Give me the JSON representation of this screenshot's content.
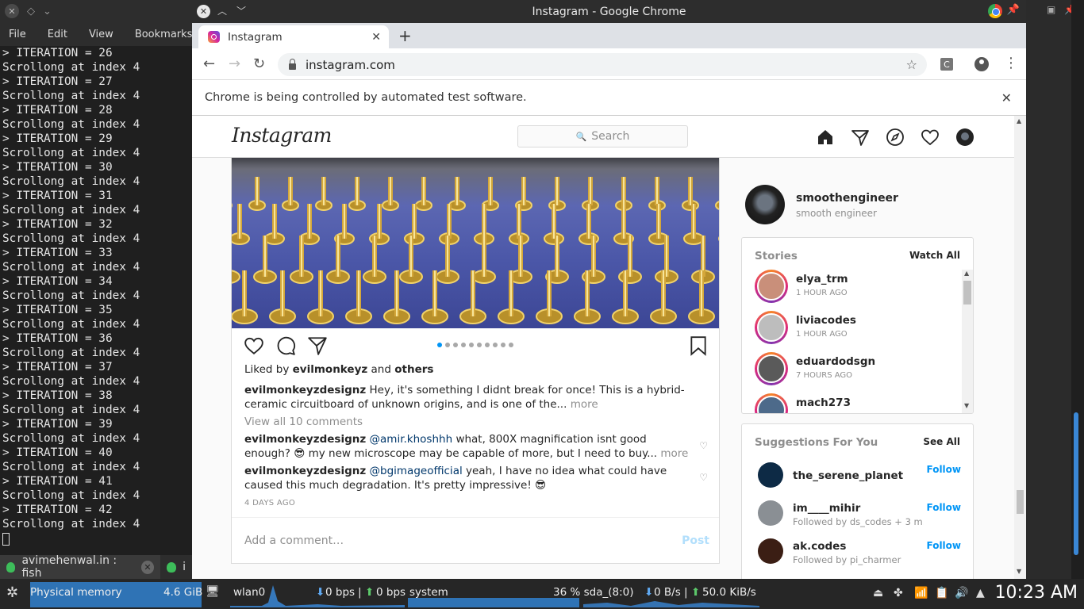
{
  "terminal": {
    "menu": [
      "File",
      "Edit",
      "View",
      "Bookmarks"
    ],
    "lines": [
      "> ITERATION = 26",
      "Scrollong at index 4",
      "> ITERATION = 27",
      "Scrollong at index 4",
      "> ITERATION = 28",
      "Scrollong at index 4",
      "> ITERATION = 29",
      "Scrollong at index 4",
      "> ITERATION = 30",
      "Scrollong at index 4",
      "> ITERATION = 31",
      "Scrollong at index 4",
      "> ITERATION = 32",
      "Scrollong at index 4",
      "> ITERATION = 33",
      "Scrollong at index 4",
      "> ITERATION = 34",
      "Scrollong at index 4",
      "> ITERATION = 35",
      "Scrollong at index 4",
      "> ITERATION = 36",
      "Scrollong at index 4",
      "> ITERATION = 37",
      "Scrollong at index 4",
      "> ITERATION = 38",
      "Scrollong at index 4",
      "> ITERATION = 39",
      "Scrollong at index 4",
      "> ITERATION = 40",
      "Scrollong at index 4",
      "> ITERATION = 41",
      "Scrollong at index 4",
      "> ITERATION = 42",
      "Scrollong at index 4"
    ],
    "tab_label": "avimehenwal.in : fish",
    "tab2_label": "i"
  },
  "chrome": {
    "window_title": "Instagram - Google Chrome",
    "tab_title": "Instagram",
    "url": "instagram.com",
    "extension_letter": "C",
    "infobar": "Chrome is being controlled by automated test software."
  },
  "instagram": {
    "logo": "Instagram",
    "search_placeholder": "Search",
    "post": {
      "liked_by_prefix": "Liked by",
      "liked_by_user": "evilmonkeyz",
      "liked_by_and": "and",
      "liked_by_others": "others",
      "caption_user": "evilmonkeyzdesignz",
      "caption_text": "Hey, it's something I didnt break for once! This is a hybrid-ceramic circuitboard of unknown origins, and is one of the...",
      "caption_more": "more",
      "view_comments": "View all 10 comments",
      "comments": [
        {
          "user": "evilmonkeyzdesignz",
          "mention": "@amir.khoshhh",
          "text": "what, 800X magnification isnt good enough? 😎 my new microscope may be capable of more, but I need to buy...",
          "more": "more"
        },
        {
          "user": "evilmonkeyzdesignz",
          "mention": "@bgimageofficial",
          "text": "yeah, I have no idea what could have caused this much degradation. It's pretty impressive! 😎",
          "more": ""
        }
      ],
      "time": "4 DAYS AGO",
      "add_comment_placeholder": "Add a comment…",
      "post_button": "Post",
      "carousel_count": 10,
      "carousel_active": 0
    },
    "me": {
      "username": "smoothengineer",
      "name": "smooth engineer"
    },
    "stories": {
      "title": "Stories",
      "watch_all": "Watch All",
      "items": [
        {
          "user": "elya_trm",
          "ago": "1 HOUR AGO",
          "color": "#c98f7a"
        },
        {
          "user": "liviacodes",
          "ago": "1 HOUR AGO",
          "color": "#bdbdbd"
        },
        {
          "user": "eduardodsgn",
          "ago": "7 HOURS AGO",
          "color": "#5a5a5a"
        },
        {
          "user": "mach273",
          "ago": "",
          "color": "#4d6a8a"
        }
      ]
    },
    "suggestions": {
      "title": "Suggestions For You",
      "see_all": "See All",
      "items": [
        {
          "user": "the_serene_planet",
          "sub": "",
          "action": "Follow",
          "color": "#0d2a45"
        },
        {
          "user": "im____mihir",
          "sub": "Followed by ds_codes + 3 m...",
          "action": "Follow",
          "color": "#8a8f94"
        },
        {
          "user": "ak.codes",
          "sub": "Followed by pi_charmer",
          "action": "Follow",
          "color": "#3b1e14"
        }
      ]
    }
  },
  "panel": {
    "mem_label": "Physical memory",
    "mem_value": "4.6 GiB",
    "net_if": "wlan0",
    "net_down": "0 bps",
    "net_sep": "|",
    "net_up": "0 bps",
    "net_suffix": "system",
    "disk": "36 % sda_(8:0)",
    "disk_read": "0 B/s",
    "disk_sep": "|",
    "disk_write": "50.0 KiB/s",
    "clock": "10:23 AM",
    "accent": "#3a87d6"
  }
}
